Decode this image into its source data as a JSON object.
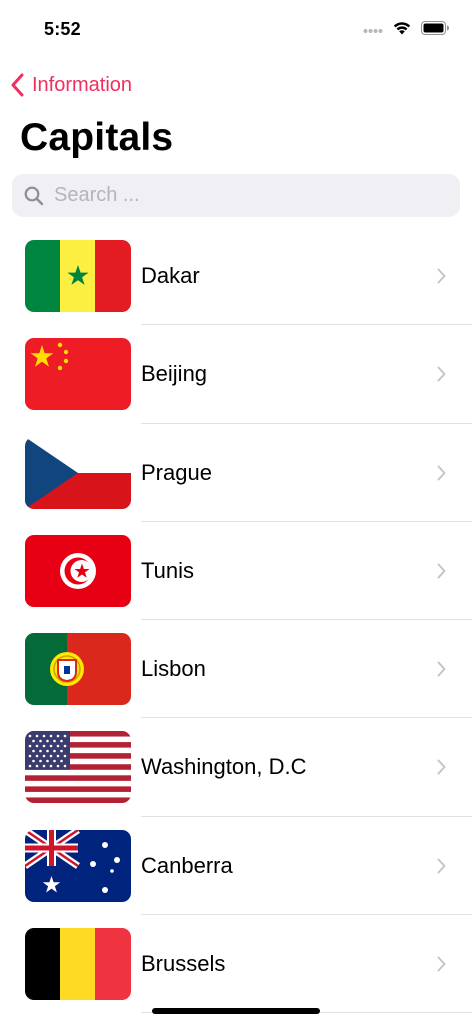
{
  "status_bar": {
    "time": "5:52",
    "icons": [
      "cellular-signal-icon",
      "wifi-icon",
      "battery-icon"
    ]
  },
  "nav": {
    "back_label": "Information",
    "accent_color": "#ee2f5f"
  },
  "title": "Capitals",
  "search": {
    "placeholder": "Search ...",
    "value": ""
  },
  "capitals": [
    {
      "city": "Dakar",
      "flag": "senegal-flag-icon"
    },
    {
      "city": "Beijing",
      "flag": "china-flag-icon"
    },
    {
      "city": "Prague",
      "flag": "czech-republic-flag-icon"
    },
    {
      "city": "Tunis",
      "flag": "tunisia-flag-icon"
    },
    {
      "city": "Lisbon",
      "flag": "portugal-flag-icon"
    },
    {
      "city": "Washington, D.C",
      "flag": "usa-flag-icon"
    },
    {
      "city": "Canberra",
      "flag": "australia-flag-icon"
    },
    {
      "city": "Brussels",
      "flag": "belgium-flag-icon"
    }
  ]
}
